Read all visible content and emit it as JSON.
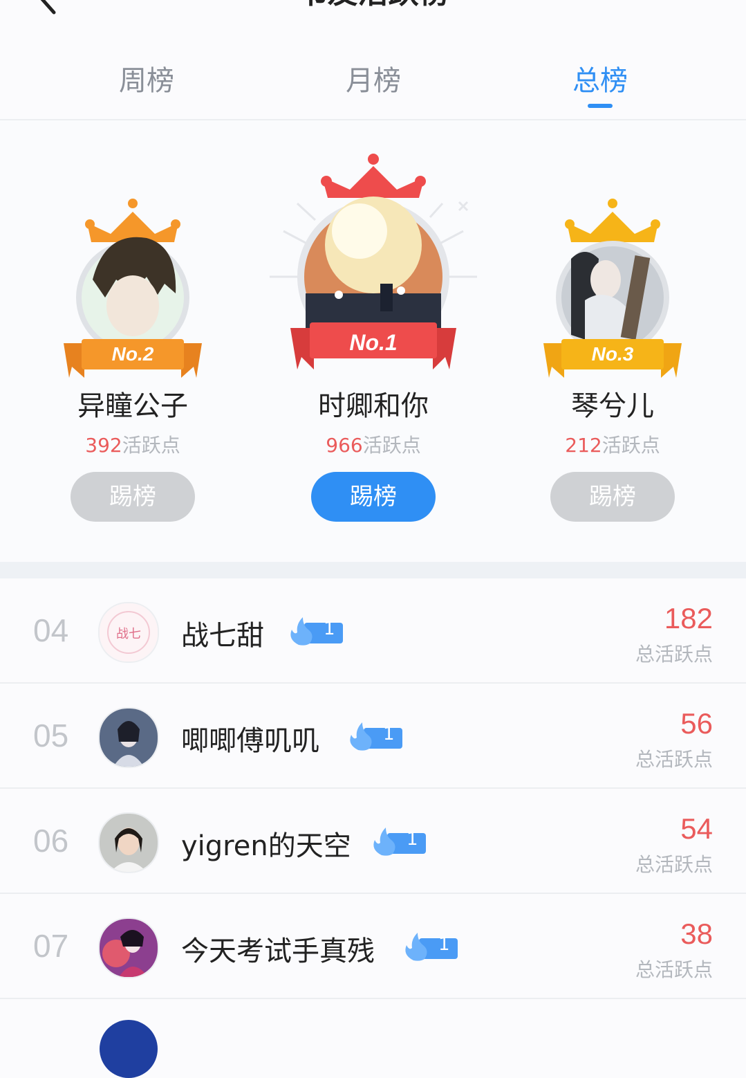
{
  "header": {
    "title": "书友活跃榜"
  },
  "tabs": [
    {
      "label": "周榜",
      "active": false
    },
    {
      "label": "月榜",
      "active": false
    },
    {
      "label": "总榜",
      "active": true
    }
  ],
  "podium": [
    {
      "rank_label": "No.2",
      "name": "异瞳公子",
      "score": "392",
      "score_unit": "活跃点",
      "button": "踢榜",
      "button_active": false,
      "crown_color": "#f5972a"
    },
    {
      "rank_label": "No.1",
      "name": "时卿和你",
      "score": "966",
      "score_unit": "活跃点",
      "button": "踢榜",
      "button_active": true,
      "crown_color": "#ee4c4c"
    },
    {
      "rank_label": "No.3",
      "name": "琴兮儿",
      "score": "212",
      "score_unit": "活跃点",
      "button": "踢榜",
      "button_active": false,
      "crown_color": "#f6b418"
    }
  ],
  "list": [
    {
      "index": "04",
      "name": "战七甜",
      "badge": "1",
      "score": "182",
      "score_label": "总活跃点"
    },
    {
      "index": "05",
      "name": "唧唧傅叽叽",
      "badge": "1",
      "score": "56",
      "score_label": "总活跃点"
    },
    {
      "index": "06",
      "name": "yigren的天空",
      "badge": "1",
      "score": "54",
      "score_label": "总活跃点"
    },
    {
      "index": "07",
      "name": "今天考试手真残",
      "badge": "1",
      "score": "38",
      "score_label": "总活跃点"
    }
  ],
  "colors": {
    "accent": "#2f8ff4",
    "score": "#ea5b5b",
    "muted": "#b3b7bd"
  }
}
